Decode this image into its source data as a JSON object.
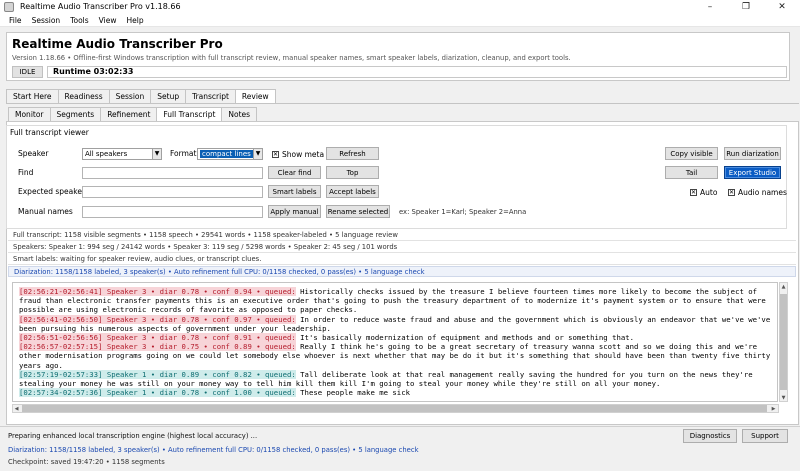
{
  "window": {
    "title": "Realtime Audio Transcriber Pro v1.18.66",
    "minimize": "–",
    "restore": "❐",
    "close": "✕"
  },
  "menu": [
    "File",
    "Session",
    "Tools",
    "View",
    "Help"
  ],
  "header": {
    "title": "Realtime Audio Transcriber Pro",
    "subtitle": "Version 1.18.66 • Offline-first Windows transcription with full transcript review, manual speaker names, smart speaker labels, diarization, cleanup, and export tools.",
    "status": "IDLE",
    "runtime": "Runtime 03:02:33"
  },
  "main_tabs": [
    "Start Here",
    "Readiness",
    "Session",
    "Setup",
    "Transcript",
    "Review"
  ],
  "sub_tabs": [
    "Monitor",
    "Segments",
    "Refinement",
    "Full Transcript",
    "Notes"
  ],
  "viewer": {
    "title": "Full transcript viewer",
    "speaker_label": "Speaker",
    "speaker_value": "All speakers",
    "format_label": "Format",
    "format_value": "compact lines",
    "show_meta": "Show meta",
    "refresh": "Refresh",
    "copy_visible": "Copy visible",
    "run_diarization": "Run diarization",
    "find_label": "Find",
    "find_value": "",
    "clear_find": "Clear find",
    "top": "Top",
    "tail": "Tail",
    "export_studio": "Export Studio",
    "expected_label": "Expected speakers",
    "expected_value": "",
    "smart_labels": "Smart labels",
    "accept_labels": "Accept labels",
    "auto": "Auto",
    "audio_names": "Audio names",
    "manual_label": "Manual names",
    "manual_value": "",
    "apply_manual": "Apply manual",
    "rename_selected": "Rename selected",
    "manual_hint": "ex: Speaker 1=Karl; Speaker 2=Anna"
  },
  "stats": {
    "full": "Full transcript: 1158 visible segments • 1158 speech • 29541 words • 1158 speaker-labeled • 5 language review",
    "speakers": "Speakers: Speaker 1: 994 seg / 24142 words • Speaker 3: 119 seg / 5298 words • Speaker 2: 45 seg / 101 words",
    "smart": "Smart labels: waiting for speaker review, audio clues, or transcript clues.",
    "diarization": "Diarization: 1158/1158 labeled, 3 speaker(s) • Auto refinement full CPU: 0/1158 checked, 0 pass(es) • 5 language check"
  },
  "transcript": [
    {
      "style": "pink",
      "meta": "[02:56:21-02:56:41] Speaker 3 • diar 0.78 • conf 0.94 • queued:",
      "text": " Historically checks issued by the treasure I believe fourteen times more likely to become the subject of fraud than electronic transfer payments this is an executive order that's going to push the treasury department of to modernize it's payment system or to ensure that were possible are using electronic records of favorite as opposed to paper checks."
    },
    {
      "style": "pink",
      "meta": "[02:56:41-02:56:50] Speaker 3 • diar 0.78 • conf 0.97 • queued:",
      "text": " In order to reduce waste fraud and abuse and the government which is obviously an endeavor that we've we've been pursuing his numerous aspects of government under your leadership."
    },
    {
      "style": "pink",
      "meta": "[02:56:51-02:56:56] Speaker 3 • diar 0.78 • conf 0.91 • queued:",
      "text": " It's basically modernization of equipment and methods and or something that."
    },
    {
      "style": "pink",
      "meta": "[02:56:57-02:57:15] Speaker 3 • diar 0.75 • conf 0.89 • queued:",
      "text": " Really I think he's going to be a great secretary of treasury wanna scott and so we doing this and we're other modernisation programs going on we could let somebody else whoever is next whether that may be do it but it's something that should have been than twenty five thirty years ago."
    },
    {
      "style": "teal",
      "meta": "[02:57:19-02:57:33] Speaker 1 • diar 0.89 • conf 0.82 • queued:",
      "text": " Tall deliberate look at that real management really saving the hundred for you turn on the news they're stealing your money he was still on your money way to tell him kill them kill I'm going to steal your money while they're still on all your money."
    },
    {
      "style": "teal",
      "meta": "[02:57:34-02:57:36] Speaker 1 • diar 0.78 • conf 1.00 • queued:",
      "text": " These people make me sick"
    }
  ],
  "footer": {
    "status": "Preparing enhanced local transcription engine (highest local accuracy) ...",
    "diarization": "Diarization: 1158/1158 labeled, 3 speaker(s) • Auto refinement full CPU: 0/1158 checked, 0 pass(es) • 5 language check",
    "checkpoint": "Checkpoint: saved 19:47:20 • 1158 segments",
    "diagnostics": "Diagnostics",
    "support": "Support"
  },
  "colors": {
    "accent": "#0b5cc4",
    "pink_meta_bg": "#f7d4d8",
    "pink_meta_fg": "#b41c2c",
    "teal_meta_bg": "#cfeceb",
    "teal_meta_fg": "#0f6e72"
  },
  "icons": {
    "dropdown": "chevron-down-icon",
    "check": "checkmark-icon"
  }
}
